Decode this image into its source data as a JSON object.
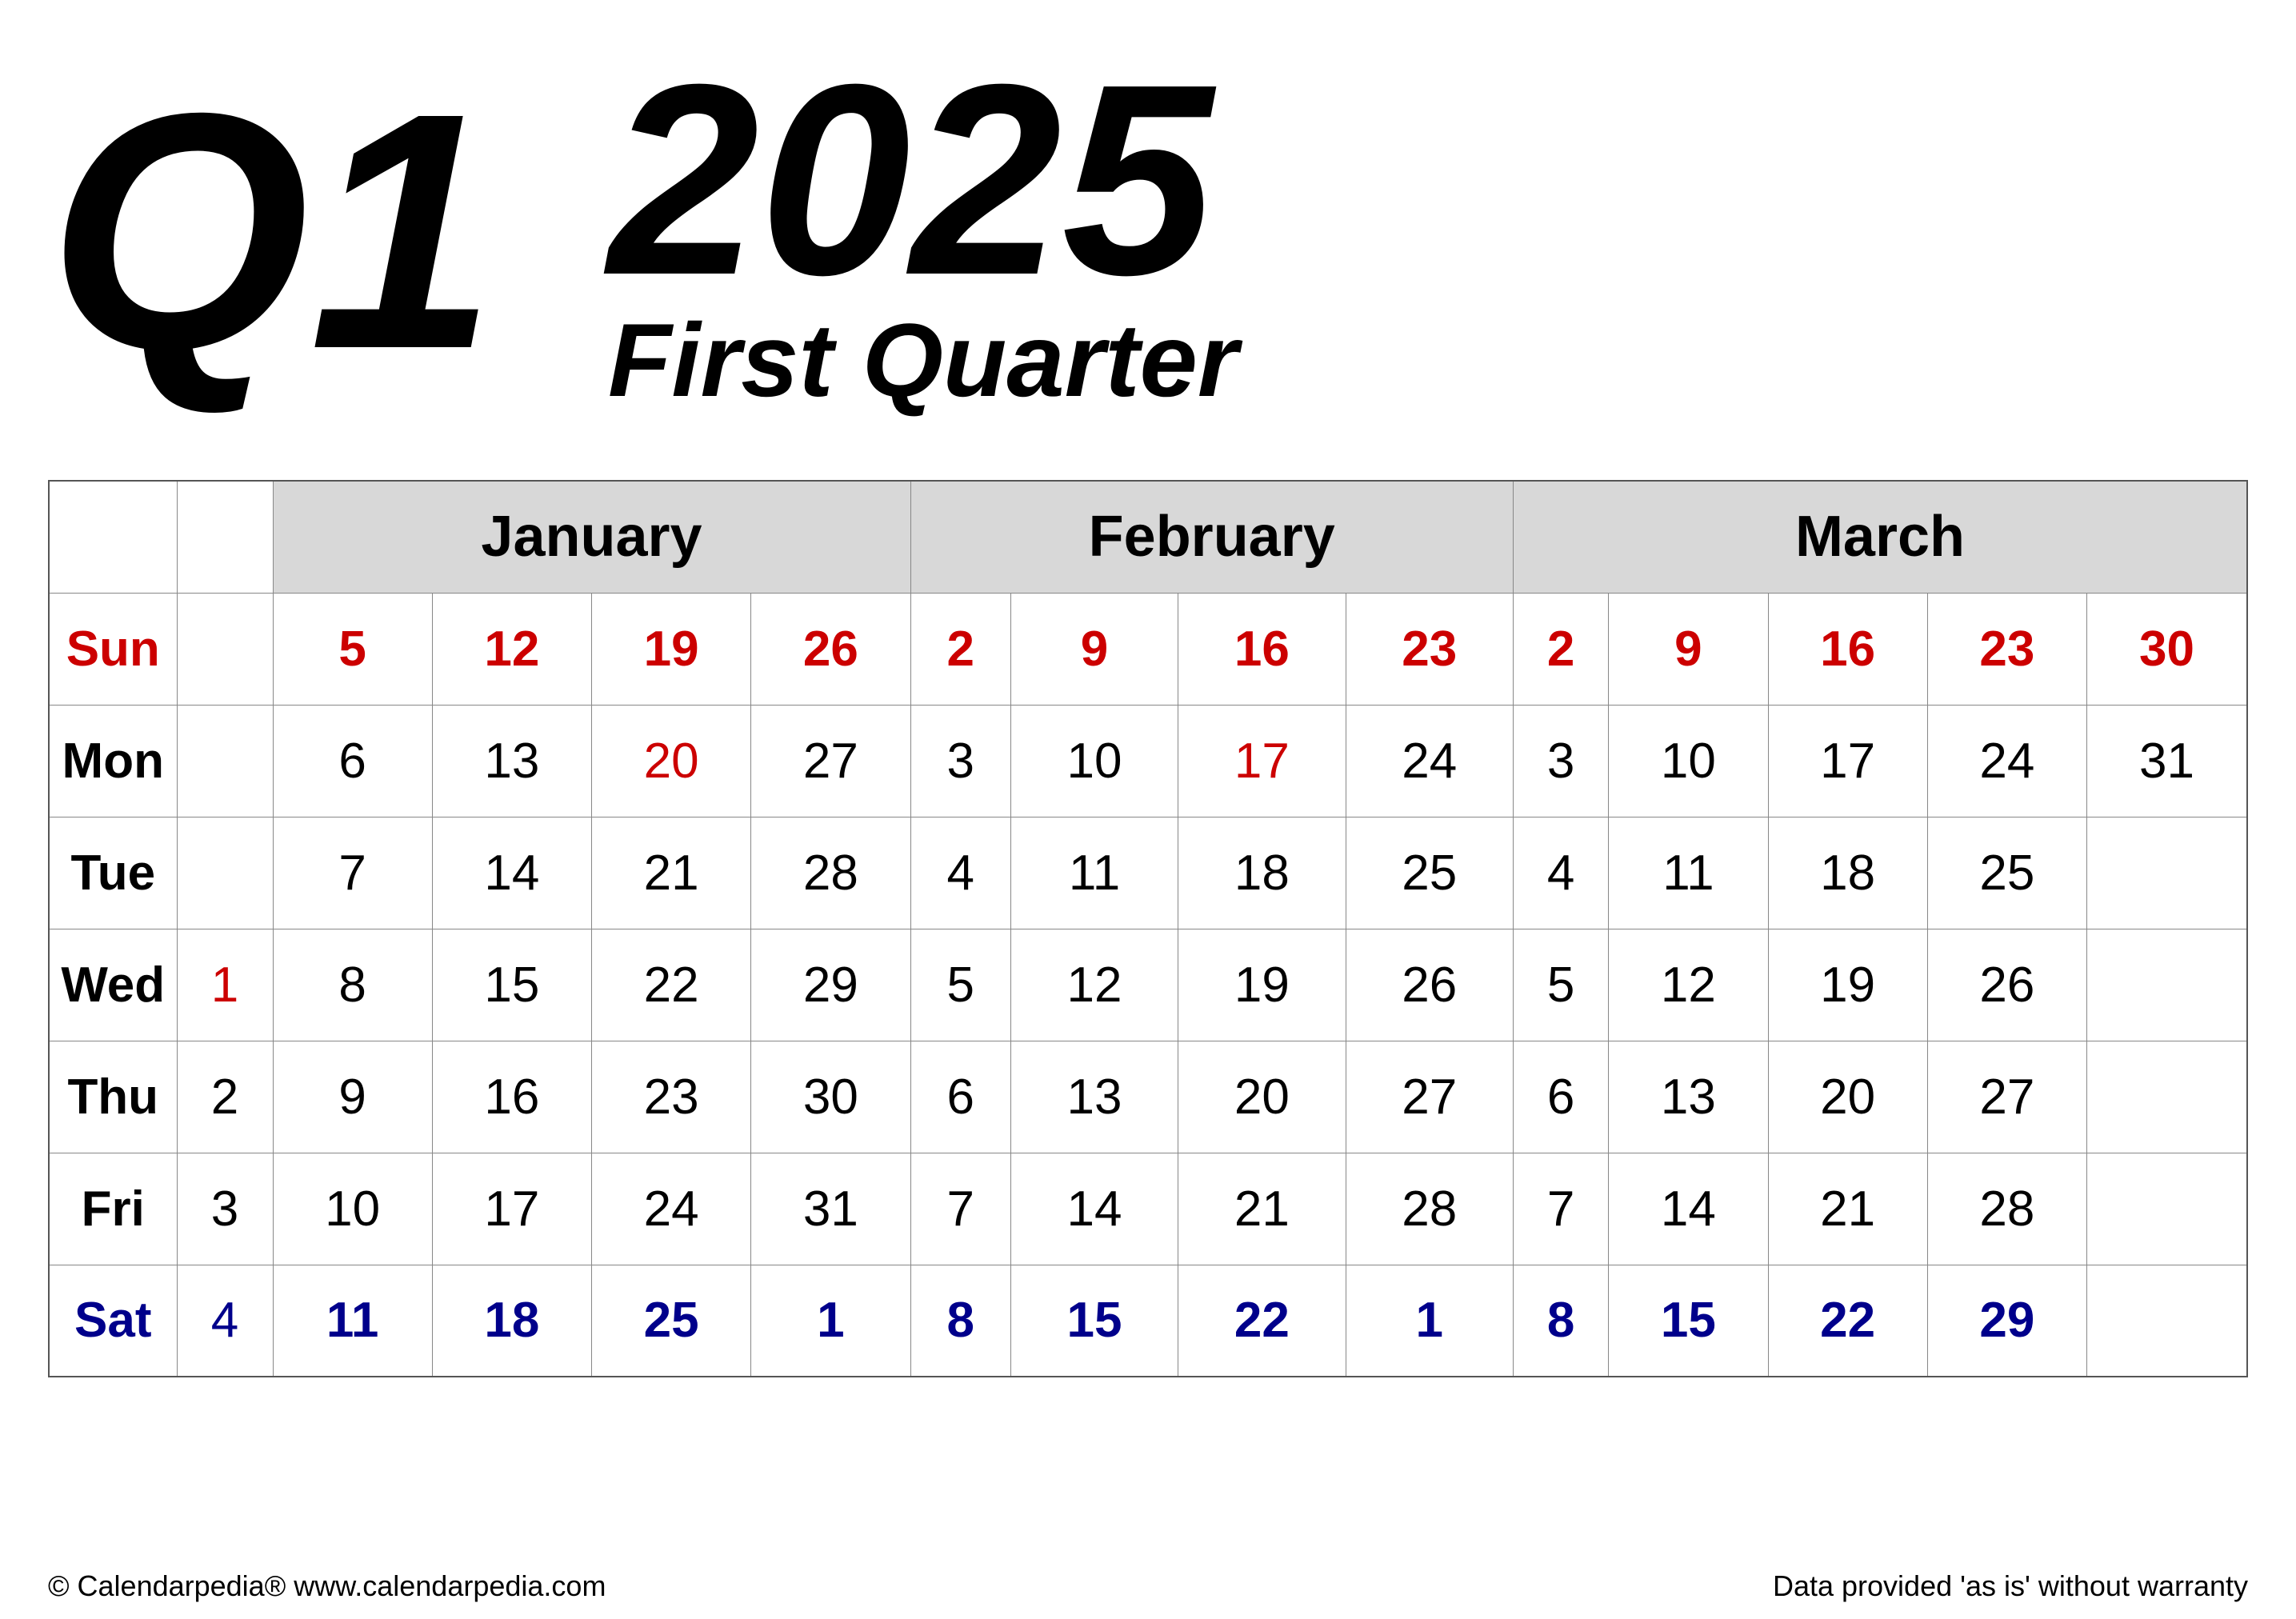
{
  "header": {
    "q1_label": "Q1",
    "year": "2025",
    "quarter_title": "First Quarter"
  },
  "calendar": {
    "months": [
      "January",
      "February",
      "March"
    ],
    "days": [
      "Sun",
      "Mon",
      "Tue",
      "Wed",
      "Thu",
      "Fri",
      "Sat"
    ],
    "rows": [
      {
        "day": "Sun",
        "type": "sunday",
        "week": "",
        "jan": [
          "5",
          "12",
          "19",
          "26"
        ],
        "feb": [
          "2",
          "9",
          "16",
          "23"
        ],
        "mar": [
          "2",
          "9",
          "16",
          "23",
          "30"
        ],
        "jan_colors": [
          "red",
          "red",
          "red",
          "red"
        ],
        "feb_colors": [
          "red",
          "red",
          "red",
          "red"
        ],
        "mar_colors": [
          "red",
          "red",
          "red",
          "red",
          "red"
        ]
      },
      {
        "day": "Mon",
        "type": "regular",
        "week": "",
        "jan": [
          "6",
          "13",
          "20",
          "27"
        ],
        "feb": [
          "3",
          "10",
          "17",
          "24"
        ],
        "mar": [
          "3",
          "10",
          "17",
          "24",
          "31"
        ],
        "jan_colors": [
          "black",
          "black",
          "red",
          "black"
        ],
        "feb_colors": [
          "black",
          "black",
          "red",
          "black"
        ],
        "mar_colors": [
          "black",
          "black",
          "black",
          "black",
          "black"
        ]
      },
      {
        "day": "Tue",
        "type": "regular",
        "week": "",
        "jan": [
          "7",
          "14",
          "21",
          "28"
        ],
        "feb": [
          "4",
          "11",
          "18",
          "25"
        ],
        "mar": [
          "4",
          "11",
          "18",
          "25",
          ""
        ],
        "jan_colors": [
          "black",
          "black",
          "black",
          "black"
        ],
        "feb_colors": [
          "black",
          "black",
          "black",
          "black"
        ],
        "mar_colors": [
          "black",
          "black",
          "black",
          "black",
          ""
        ]
      },
      {
        "day": "Wed",
        "type": "regular",
        "week": "1",
        "week_color": "red",
        "jan": [
          "8",
          "15",
          "22",
          "29"
        ],
        "feb": [
          "5",
          "12",
          "19",
          "26"
        ],
        "mar": [
          "5",
          "12",
          "19",
          "26",
          ""
        ],
        "jan_colors": [
          "black",
          "black",
          "black",
          "black"
        ],
        "feb_colors": [
          "black",
          "black",
          "black",
          "black"
        ],
        "mar_colors": [
          "black",
          "black",
          "black",
          "black",
          ""
        ]
      },
      {
        "day": "Thu",
        "type": "regular",
        "week": "2",
        "week_color": "black",
        "jan": [
          "9",
          "16",
          "23",
          "30"
        ],
        "feb": [
          "6",
          "13",
          "20",
          "27"
        ],
        "mar": [
          "6",
          "13",
          "20",
          "27",
          ""
        ],
        "jan_colors": [
          "black",
          "black",
          "black",
          "black"
        ],
        "feb_colors": [
          "black",
          "black",
          "black",
          "black"
        ],
        "mar_colors": [
          "black",
          "black",
          "black",
          "black",
          ""
        ]
      },
      {
        "day": "Fri",
        "type": "regular",
        "week": "3",
        "week_color": "black",
        "jan": [
          "10",
          "17",
          "24",
          "31"
        ],
        "feb": [
          "7",
          "14",
          "21",
          "28"
        ],
        "mar": [
          "7",
          "14",
          "21",
          "28",
          ""
        ],
        "jan_colors": [
          "black",
          "black",
          "black",
          "black"
        ],
        "feb_colors": [
          "black",
          "black",
          "black",
          "black"
        ],
        "mar_colors": [
          "black",
          "black",
          "black",
          "black",
          ""
        ]
      },
      {
        "day": "Sat",
        "type": "saturday",
        "week": "4",
        "week_color": "blue",
        "jan": [
          "11",
          "18",
          "25",
          "1"
        ],
        "feb": [
          "8",
          "15",
          "22",
          "1"
        ],
        "mar": [
          "8",
          "15",
          "22",
          "29",
          ""
        ],
        "jan_colors": [
          "blue",
          "blue",
          "blue",
          "blue"
        ],
        "feb_colors": [
          "blue",
          "blue",
          "blue",
          "blue"
        ],
        "mar_colors": [
          "blue",
          "blue",
          "blue",
          "blue",
          ""
        ]
      }
    ]
  },
  "footer": {
    "left": "© Calendarpedia®  www.calendarpedia.com",
    "right": "Data provided 'as is' without warranty"
  }
}
